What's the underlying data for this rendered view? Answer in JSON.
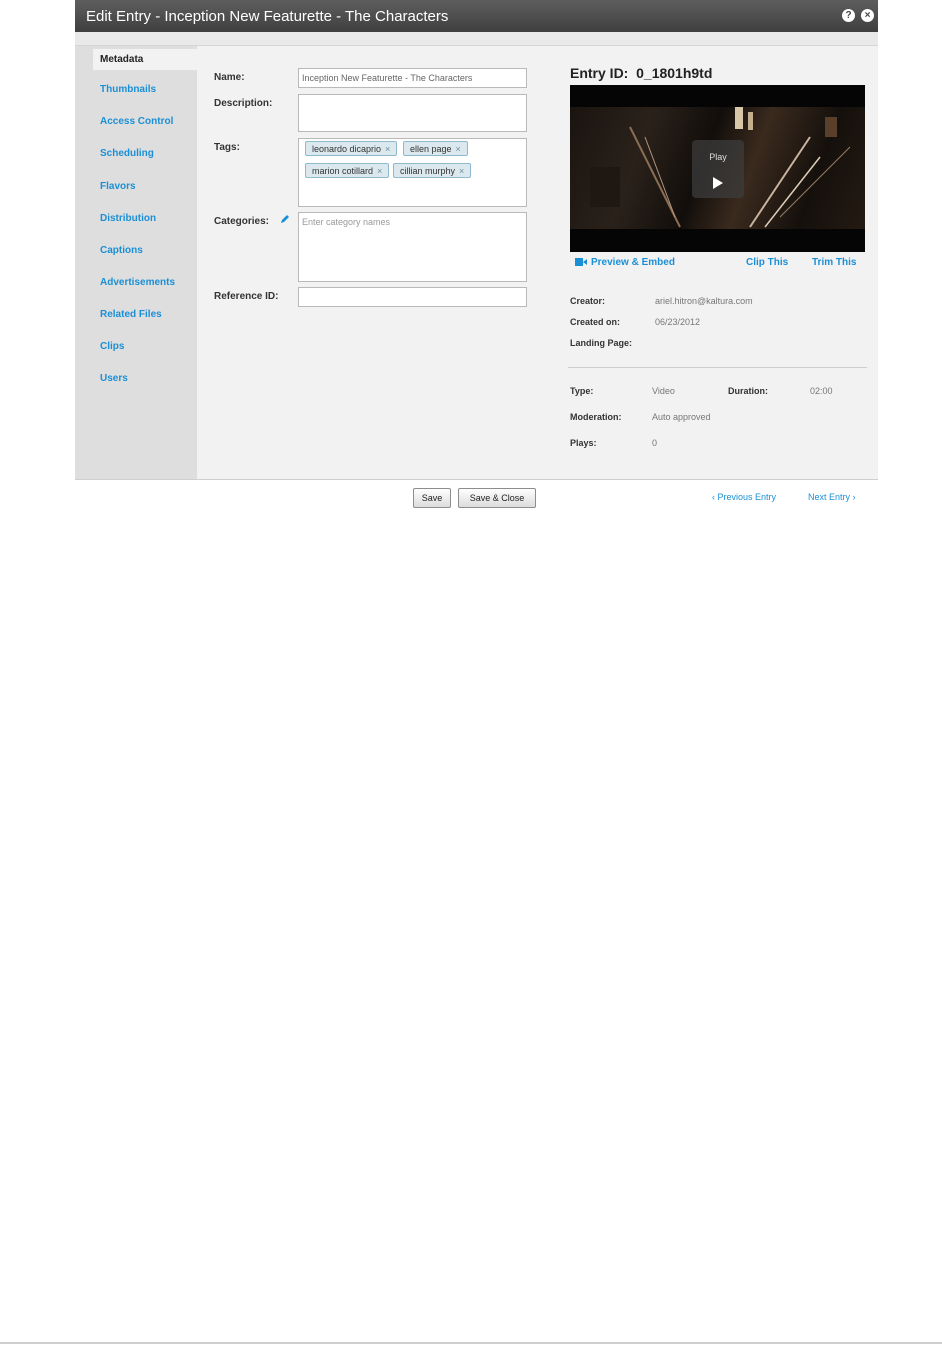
{
  "dialog": {
    "title": "Edit Entry - Inception  New Featurette - The Characters",
    "help_icon": "question-icon",
    "close_icon": "close-icon"
  },
  "sidebar": {
    "items": [
      {
        "label": "Metadata",
        "active": true
      },
      {
        "label": "Thumbnails"
      },
      {
        "label": "Access Control"
      },
      {
        "label": "Scheduling"
      },
      {
        "label": "Flavors"
      },
      {
        "label": "Distribution"
      },
      {
        "label": "Captions"
      },
      {
        "label": "Advertisements"
      },
      {
        "label": "Related Files"
      },
      {
        "label": "Clips"
      },
      {
        "label": "Users"
      }
    ]
  },
  "form": {
    "name_label": "Name:",
    "name_value": "Inception  New Featurette - The Characters",
    "description_label": "Description:",
    "description_value": "",
    "tags_label": "Tags:",
    "tags": [
      "leonardo dicaprio",
      "ellen page",
      "marion cotillard",
      "cillian murphy"
    ],
    "tag_remove": "×",
    "categories_label": "Categories:",
    "categories_placeholder": "Enter category names",
    "reference_label": "Reference ID:",
    "reference_value": ""
  },
  "entry": {
    "id_label": "Entry ID:",
    "id_value": "0_1801h9td",
    "play_label": "Play",
    "preview_embed": "Preview & Embed",
    "clip_this": "Clip This",
    "trim_this": "Trim This",
    "creator_label": "Creator:",
    "creator_value": "ariel.hitron@kaltura.com",
    "created_on_label": "Created on:",
    "created_on_value": "06/23/2012",
    "landing_page_label": "Landing Page:",
    "type_label": "Type:",
    "type_value": "Video",
    "duration_label": "Duration:",
    "duration_value": "02:00",
    "moderation_label": "Moderation:",
    "moderation_value": "Auto approved",
    "plays_label": "Plays:",
    "plays_value": "0"
  },
  "footer": {
    "save": "Save",
    "save_close": "Save & Close",
    "previous_entry": "Previous Entry",
    "next_entry": "Next Entry"
  }
}
